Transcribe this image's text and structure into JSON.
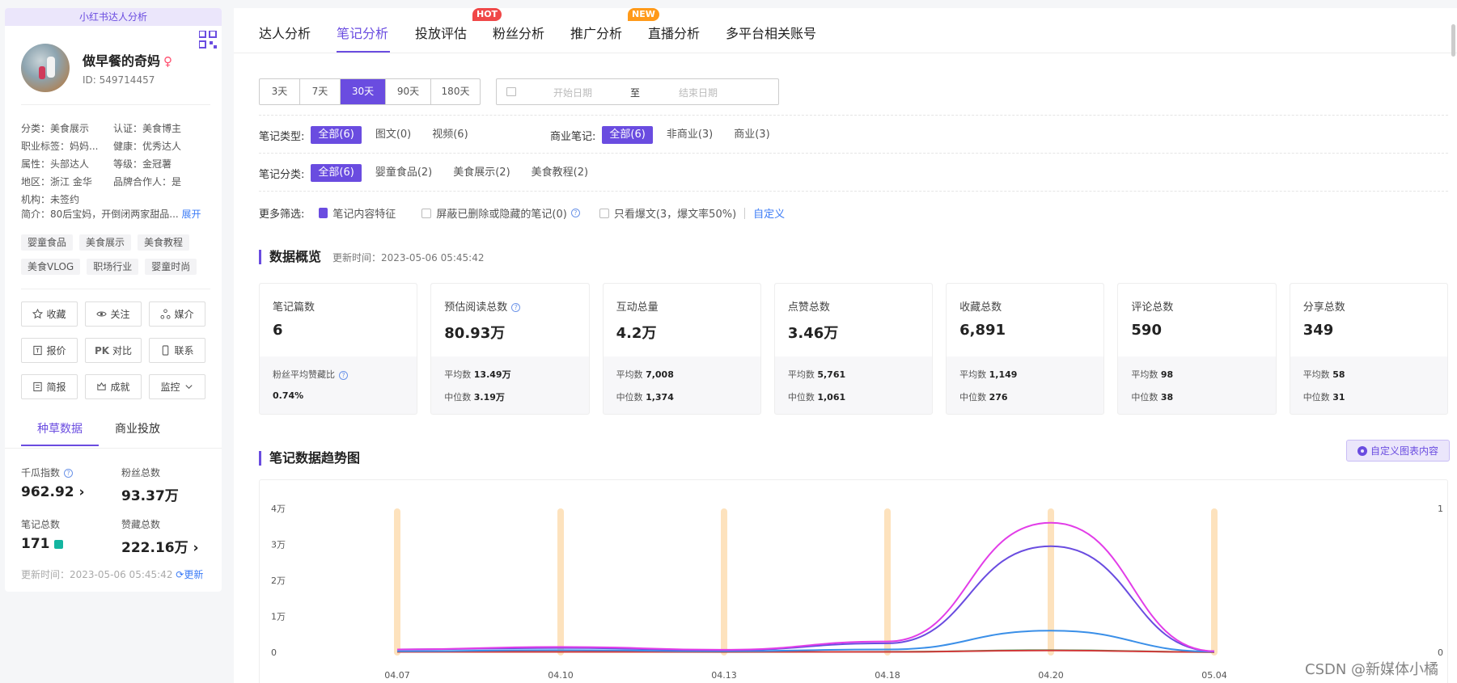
{
  "sidebar": {
    "title": "小红书达人分析",
    "name": "做早餐的奇妈",
    "gender_symbol": "♀",
    "id": "ID: 549714457",
    "attrs": [
      [
        "分类：美食展示",
        "认证：美食博主"
      ],
      [
        "职业标签：妈妈...",
        "健康：优秀达人"
      ],
      [
        "属性：头部达人",
        "等级：金冠薯"
      ],
      [
        "地区：浙江 金华",
        "品牌合作人：是"
      ],
      [
        "机构：未签约",
        ""
      ]
    ],
    "intro": "简介：80后宝妈，开倒闭两家甜品...",
    "intro_more": "展开",
    "tags": [
      "婴童食品",
      "美食展示",
      "美食教程",
      "美食VLOG",
      "职场行业",
      "婴童时尚"
    ],
    "buttons": [
      "收藏",
      "关注",
      "媒介",
      "报价",
      "对比",
      "联系",
      "简报",
      "成就",
      "监控"
    ],
    "pk_prefix": "PK",
    "tabs": [
      "种草数据",
      "商业投放"
    ],
    "stats": [
      {
        "label": "千瓜指数",
        "value": "962.92",
        "suffix": "›"
      },
      {
        "label": "粉丝总数",
        "value": "93.37万",
        "suffix": ""
      },
      {
        "label": "笔记总数",
        "value": "171",
        "suffix": ""
      },
      {
        "label": "赞藏总数",
        "value": "222.16万",
        "suffix": "›"
      }
    ],
    "updated_label": "更新时间：2023-05-06 05:45:42",
    "update_link": "更新"
  },
  "nav": {
    "items": [
      "达人分析",
      "笔记分析",
      "投放评估",
      "粉丝分析",
      "推广分析",
      "直播分析",
      "多平台相关账号"
    ],
    "active_index": 1,
    "hot_badge": "HOT",
    "new_badge": "NEW"
  },
  "filters": {
    "ranges": [
      "3天",
      "7天",
      "30天",
      "90天",
      "180天"
    ],
    "range_active": "30天",
    "start_placeholder": "开始日期",
    "to": "至",
    "end_placeholder": "结束日期",
    "note_type_label": "笔记类型:",
    "note_types": [
      "全部(6)",
      "图文(0)",
      "视频(6)"
    ],
    "biz_label": "商业笔记:",
    "biz_types": [
      "全部(6)",
      "非商业(3)",
      "商业(3)"
    ],
    "category_label": "笔记分类:",
    "categories": [
      "全部(6)",
      "婴童食品(2)",
      "美食展示(2)",
      "美食教程(2)"
    ],
    "more_label": "更多筛选:",
    "content_feature": "笔记内容特征",
    "hide_deleted": "屏蔽已删除或隐藏的笔记(0)",
    "only_hits": "只看爆文(3，爆文率50%)",
    "customize": "自定义"
  },
  "overview": {
    "title": "数据概览",
    "updated": "更新时间：2023-05-06 05:45:42",
    "cards": [
      {
        "label": "笔记篇数",
        "value": "6",
        "r1_label": "粉丝平均赞藏比",
        "r1_value": "",
        "r2_label": "",
        "r2_value": "0.74%"
      },
      {
        "label": "预估阅读总数",
        "value": "80.93万",
        "r1_label": "平均数",
        "r1_value": "13.49万",
        "r2_label": "中位数",
        "r2_value": "3.19万"
      },
      {
        "label": "互动总量",
        "value": "4.2万",
        "r1_label": "平均数",
        "r1_value": "7,008",
        "r2_label": "中位数",
        "r2_value": "1,374"
      },
      {
        "label": "点赞总数",
        "value": "3.46万",
        "r1_label": "平均数",
        "r1_value": "5,761",
        "r2_label": "中位数",
        "r2_value": "1,061"
      },
      {
        "label": "收藏总数",
        "value": "6,891",
        "r1_label": "平均数",
        "r1_value": "1,149",
        "r2_label": "中位数",
        "r2_value": "276"
      },
      {
        "label": "评论总数",
        "value": "590",
        "r1_label": "平均数",
        "r1_value": "98",
        "r2_label": "中位数",
        "r2_value": "38"
      },
      {
        "label": "分享总数",
        "value": "349",
        "r1_label": "平均数",
        "r1_value": "58",
        "r2_label": "中位数",
        "r2_value": "31"
      }
    ]
  },
  "trend": {
    "title": "笔记数据趋势图",
    "custom_button": "自定义图表内容"
  },
  "chart_data": {
    "type": "line",
    "categories": [
      "04.07",
      "04.10",
      "04.13",
      "04.18",
      "04.20",
      "05.04"
    ],
    "y_ticks": [
      "0",
      "1万",
      "2万",
      "3万",
      "4万"
    ],
    "ylim": [
      0,
      40000
    ],
    "y2_ticks": [
      "0",
      "1"
    ],
    "series": [
      {
        "values": [
          800,
          1500,
          700,
          3000,
          36000,
          300
        ],
        "color": "#e23de8"
      },
      {
        "values": [
          800,
          1200,
          600,
          2500,
          29500,
          300
        ],
        "color": "#6a4ce0"
      },
      {
        "values": [
          300,
          600,
          300,
          800,
          6000,
          200
        ],
        "color": "#3a8fe8"
      },
      {
        "values": [
          100,
          100,
          100,
          100,
          500,
          50
        ],
        "color": "#d13a3a"
      },
      {
        "values": [
          100,
          150,
          80,
          150,
          600,
          50
        ],
        "color": "#3aa85a"
      }
    ],
    "bar_color": "#fde2bd",
    "grid": false
  },
  "watermark": "CSDN @新媒体小橘"
}
